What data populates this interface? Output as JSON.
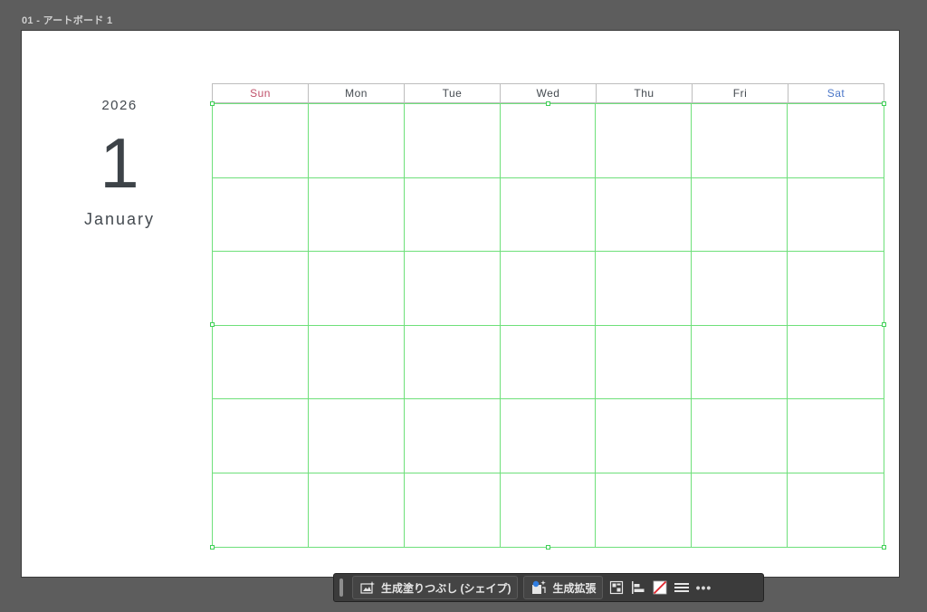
{
  "artboard": {
    "label": "01 - アートボード 1"
  },
  "calendar": {
    "year": "2026",
    "month_number": "1",
    "month_name": "January",
    "weekdays": [
      "Sun",
      "Mon",
      "Tue",
      "Wed",
      "Thu",
      "Fri",
      "Sat"
    ],
    "rows": 6,
    "columns": 7,
    "colors": {
      "sunday": "#c0506a",
      "saturday": "#4a76c8",
      "weekday": "#444a50",
      "grid": "#6ee07a"
    }
  },
  "taskbar": {
    "generative_fill_label": "生成塗りつぶし (シェイプ)",
    "generative_expand_label": "生成拡張",
    "icons": [
      "generative-fill-icon",
      "generative-expand-icon",
      "arrange-icon",
      "align-icon",
      "no-fill-icon",
      "stroke-lines-icon",
      "more-options-icon"
    ],
    "more_label": "•••"
  }
}
